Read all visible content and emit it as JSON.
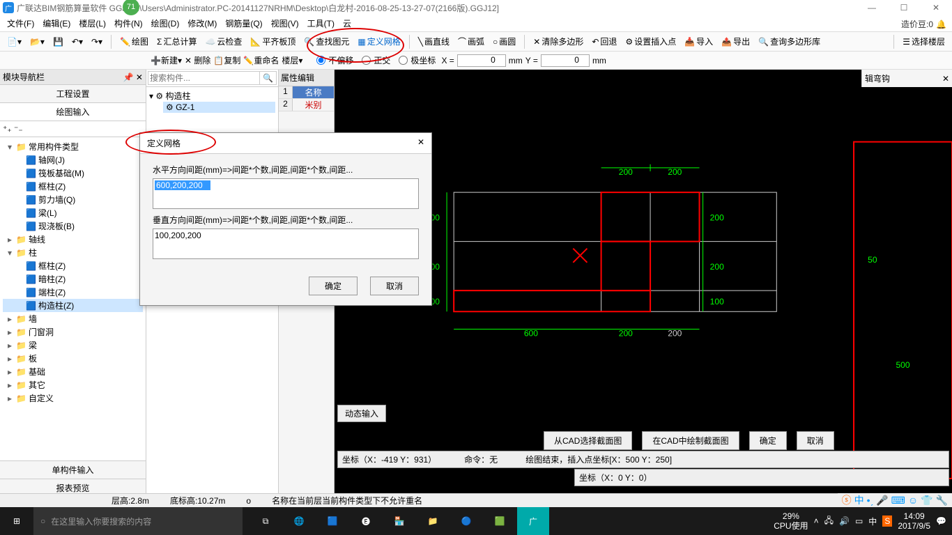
{
  "title": {
    "app_short": "广",
    "badge": "71",
    "text": "广联达BIM钢筋算量软件 GGJ        [C:\\Users\\Administrator.PC-20141127NRHM\\Desktop\\白龙村-2016-08-25-13-27-07(2166版).GGJ12]"
  },
  "win": {
    "min": "—",
    "max": "☐",
    "close": "✕"
  },
  "menu": [
    "文件(F)",
    "编辑(E)",
    "楼层(L)",
    "构件(N)",
    "绘图(D)",
    "修改(M)",
    "钢筋量(Q)",
    "视图(V)",
    "工具(T)",
    "云"
  ],
  "bean": {
    "label": "造价豆:0",
    "bell": "🔔"
  },
  "toolbar1": {
    "draw": "绘图",
    "sum": "汇总计算",
    "cloud": "云检查",
    "flat": "平齐板顶",
    "find": "查找图元",
    "grid": "定义网格",
    "line": "画直线",
    "arc": "画弧",
    "circle": "画圆",
    "clear": "清除多边形",
    "back": "回退",
    "insert": "设置插入点",
    "imp": "导入",
    "exp": "导出",
    "query": "查询多边形库",
    "floor": "选择楼层"
  },
  "toolbar2": {
    "new": "新建",
    "del": "删除",
    "copy": "复制",
    "rename": "重命名",
    "floor": "楼层",
    "r1": "不偏移",
    "r2": "正交",
    "r3": "极坐标",
    "x": "X =",
    "y": "Y =",
    "xval": "0",
    "yval": "0",
    "mm": "mm"
  },
  "nav": {
    "title": "模块导航栏",
    "tabs": {
      "proj": "工程设置",
      "draw": "绘图输入"
    },
    "tree": [
      {
        "exp": "▾",
        "ico": "📁",
        "label": "常用构件类型",
        "children": [
          {
            "ico": "🟦",
            "label": "轴网(J)"
          },
          {
            "ico": "🟦",
            "label": "筏板基础(M)"
          },
          {
            "ico": "🟦",
            "label": "框柱(Z)"
          },
          {
            "ico": "🟦",
            "label": "剪力墙(Q)"
          },
          {
            "ico": "🟦",
            "label": "梁(L)"
          },
          {
            "ico": "🟦",
            "label": "现浇板(B)"
          }
        ]
      },
      {
        "exp": "▸",
        "ico": "📁",
        "label": "轴线"
      },
      {
        "exp": "▾",
        "ico": "📁",
        "label": "柱",
        "children": [
          {
            "ico": "🟦",
            "label": "框柱(Z)"
          },
          {
            "ico": "🟦",
            "label": "暗柱(Z)"
          },
          {
            "ico": "🟦",
            "label": "端柱(Z)"
          },
          {
            "ico": "🟦",
            "label": "构造柱(Z)",
            "sel": true
          }
        ]
      },
      {
        "exp": "▸",
        "ico": "📁",
        "label": "墙"
      },
      {
        "exp": "▸",
        "ico": "📁",
        "label": "门窗洞"
      },
      {
        "exp": "▸",
        "ico": "📁",
        "label": "梁"
      },
      {
        "exp": "▸",
        "ico": "📁",
        "label": "板"
      },
      {
        "exp": "▸",
        "ico": "📁",
        "label": "基础"
      },
      {
        "exp": "▸",
        "ico": "📁",
        "label": "其它"
      },
      {
        "exp": "▸",
        "ico": "📁",
        "label": "自定义"
      }
    ],
    "bottom": {
      "single": "单构件输入",
      "report": "报表预览"
    }
  },
  "mid": {
    "search_ph": "搜索构件...",
    "root": "构造柱",
    "item": "GZ-1"
  },
  "prop": {
    "title": "属性编辑",
    "r1": {
      "n": "1",
      "l": "名称"
    },
    "r2": {
      "n": "2",
      "l": "米别"
    }
  },
  "right": {
    "label": "辑弯钩"
  },
  "canvas": {
    "dims": {
      "t1": "200",
      "t2": "200",
      "r1": "200",
      "r2": "200",
      "r3": "100",
      "b1": "600",
      "b2": "200",
      "b3": "200",
      "l1": "200",
      "l2": "200",
      "l3": "100",
      "side": "50",
      "bbot": "500"
    },
    "dyn": "动态输入",
    "btns": {
      "b1": "从CAD选择截面图",
      "b2": "在CAD中绘制截面图",
      "ok": "确定",
      "cancel": "取消"
    },
    "status": {
      "coord": "坐标（X：-419 Y：931）",
      "cmd": "命令：无",
      "end": "绘图结束，插入点坐标[X：500 Y：250]"
    },
    "coord2": "坐标（X：0 Y：0）"
  },
  "dialog": {
    "title": "定义网格",
    "close": "✕",
    "l1": "水平方向间距(mm)=>间距*个数,间距,间距*个数,间距...",
    "v1": "600,200,200",
    "l2": "垂直方向间距(mm)=>间距*个数,间距,间距*个数,间距...",
    "v2": "100,200,200",
    "ok": "确定",
    "cancel": "取消"
  },
  "status": {
    "h": "层高:2.8m",
    "bh": "底标高:10.27m",
    "o": "o",
    "msg": "名称在当前层当前构件类型下不允许重名"
  },
  "taskbar": {
    "search": "在这里输入你要搜索的内容",
    "cpu": {
      "p": "29%",
      "l": "CPU使用"
    },
    "time": "14:09",
    "date": "2017/9/5",
    "ime": "中"
  }
}
